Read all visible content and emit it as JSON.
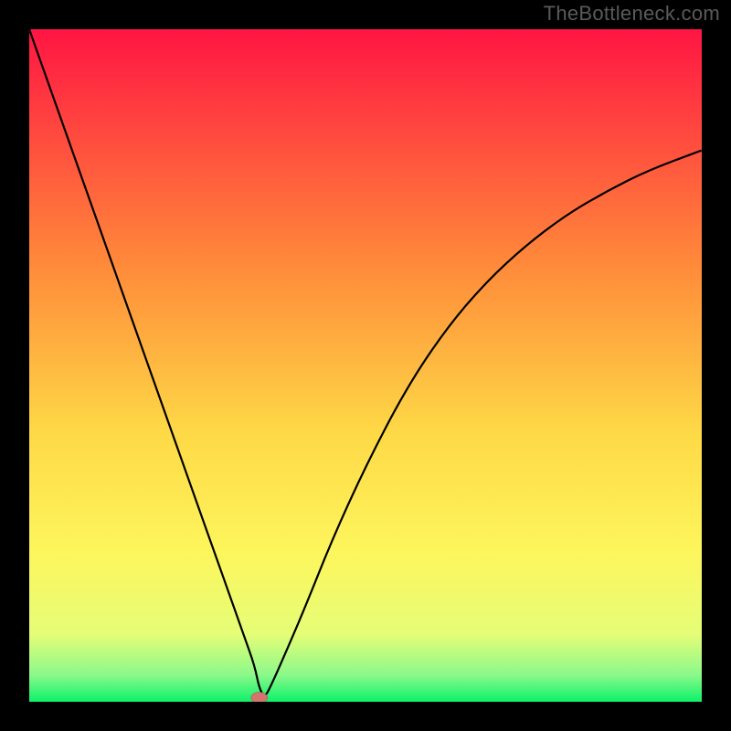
{
  "watermark": "TheBottleneck.com",
  "chart_data": {
    "type": "line",
    "title": "",
    "xlabel": "",
    "ylabel": "",
    "xlim": [
      0,
      100
    ],
    "ylim": [
      0,
      100
    ],
    "legend": false,
    "grid": false,
    "background_gradient": {
      "stops": [
        {
          "offset": 0,
          "color": "#ff1543"
        },
        {
          "offset": 35,
          "color": "#ff8a3a"
        },
        {
          "offset": 60,
          "color": "#fed946"
        },
        {
          "offset": 78,
          "color": "#fdf65d"
        },
        {
          "offset": 90,
          "color": "#e5fd77"
        },
        {
          "offset": 96,
          "color": "#8bf98a"
        },
        {
          "offset": 100,
          "color": "#0df16a"
        }
      ]
    },
    "series": [
      {
        "name": "bottleneck-curve",
        "x": [
          0,
          4,
          8,
          12,
          16,
          20,
          24,
          28,
          30,
          32,
          33.5,
          34.2,
          35,
          36,
          38,
          41,
          45,
          50,
          56,
          62,
          68,
          74,
          80,
          86,
          92,
          100
        ],
        "y": [
          100,
          88.7,
          77.4,
          66.1,
          54.8,
          43.5,
          32.2,
          20.9,
          15.3,
          9.6,
          5.4,
          2.0,
          0.6,
          2.5,
          7.0,
          14.0,
          24.0,
          35.0,
          46.5,
          55.5,
          62.5,
          68.0,
          72.5,
          76.0,
          79.0,
          82.0
        ]
      }
    ],
    "marker": {
      "x": 34.2,
      "y": 0.6,
      "color": "#d1756f"
    },
    "frame_color": "#000000",
    "line_color": "#000000"
  }
}
